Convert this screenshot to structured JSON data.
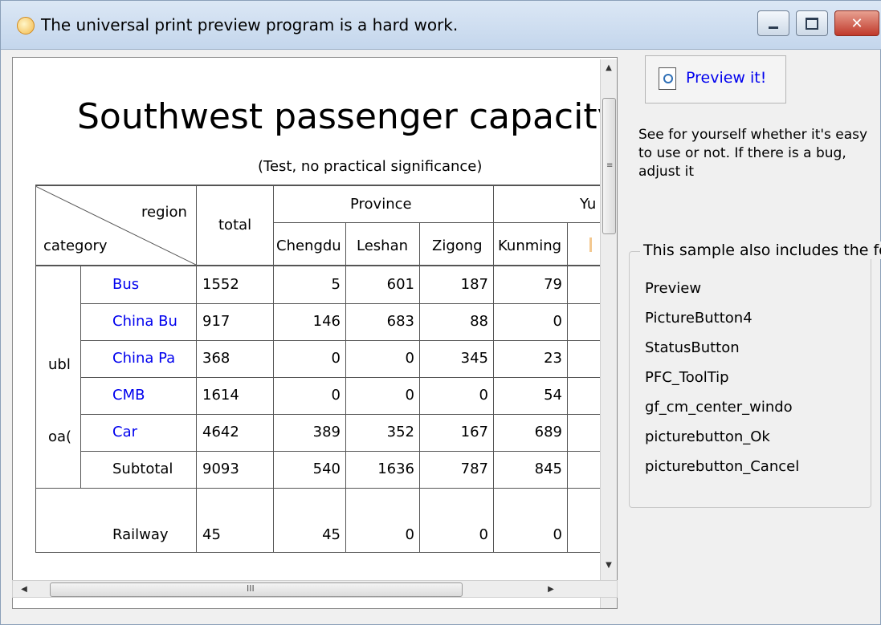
{
  "window": {
    "title": "The universal print preview program is a hard work."
  },
  "report": {
    "title": "Southwest passenger capacity sta",
    "subtitle": "(Test, no practical significance)",
    "headers": {
      "region": "region",
      "category": "category",
      "total": "total",
      "group_province": "Province",
      "group_second": "Yu",
      "columns": [
        "Chengdu",
        "Leshan",
        "Zigong",
        "Kunming"
      ]
    },
    "group_labels": [
      "ubl",
      "oa("
    ],
    "rows": [
      {
        "label": "Bus",
        "total": "1552",
        "values": [
          "5",
          "601",
          "187",
          "79"
        ]
      },
      {
        "label": "China Bu",
        "total": "917",
        "values": [
          "146",
          "683",
          "88",
          "0"
        ]
      },
      {
        "label": "China Pa",
        "total": "368",
        "values": [
          "0",
          "0",
          "345",
          "23"
        ]
      },
      {
        "label": "CMB",
        "total": "1614",
        "values": [
          "0",
          "0",
          "0",
          "54"
        ]
      },
      {
        "label": "Car",
        "total": "4642",
        "values": [
          "389",
          "352",
          "167",
          "689"
        ]
      },
      {
        "label": "Subtotal",
        "total": "9093",
        "values": [
          "540",
          "1636",
          "787",
          "845"
        ]
      },
      {
        "label": "Railway",
        "total": "45",
        "values": [
          "45",
          "0",
          "0",
          "0"
        ]
      }
    ]
  },
  "panel": {
    "preview_button": "Preview it!",
    "description": "See for yourself whether it's easy to use or not. If there is a bug, adjust it",
    "group_title": "This sample also includes the foll",
    "features": [
      "Preview",
      "PictureButton4",
      "StatusButton",
      "PFC_ToolTip",
      "gf_cm_center_windo",
      "picturebutton_Ok",
      "picturebutton_Cancel"
    ]
  },
  "scrollbar_glyph": "III",
  "colors": {
    "link": "#0000ee",
    "titlebar": "#c4d6ec",
    "close": "#c0392b"
  }
}
